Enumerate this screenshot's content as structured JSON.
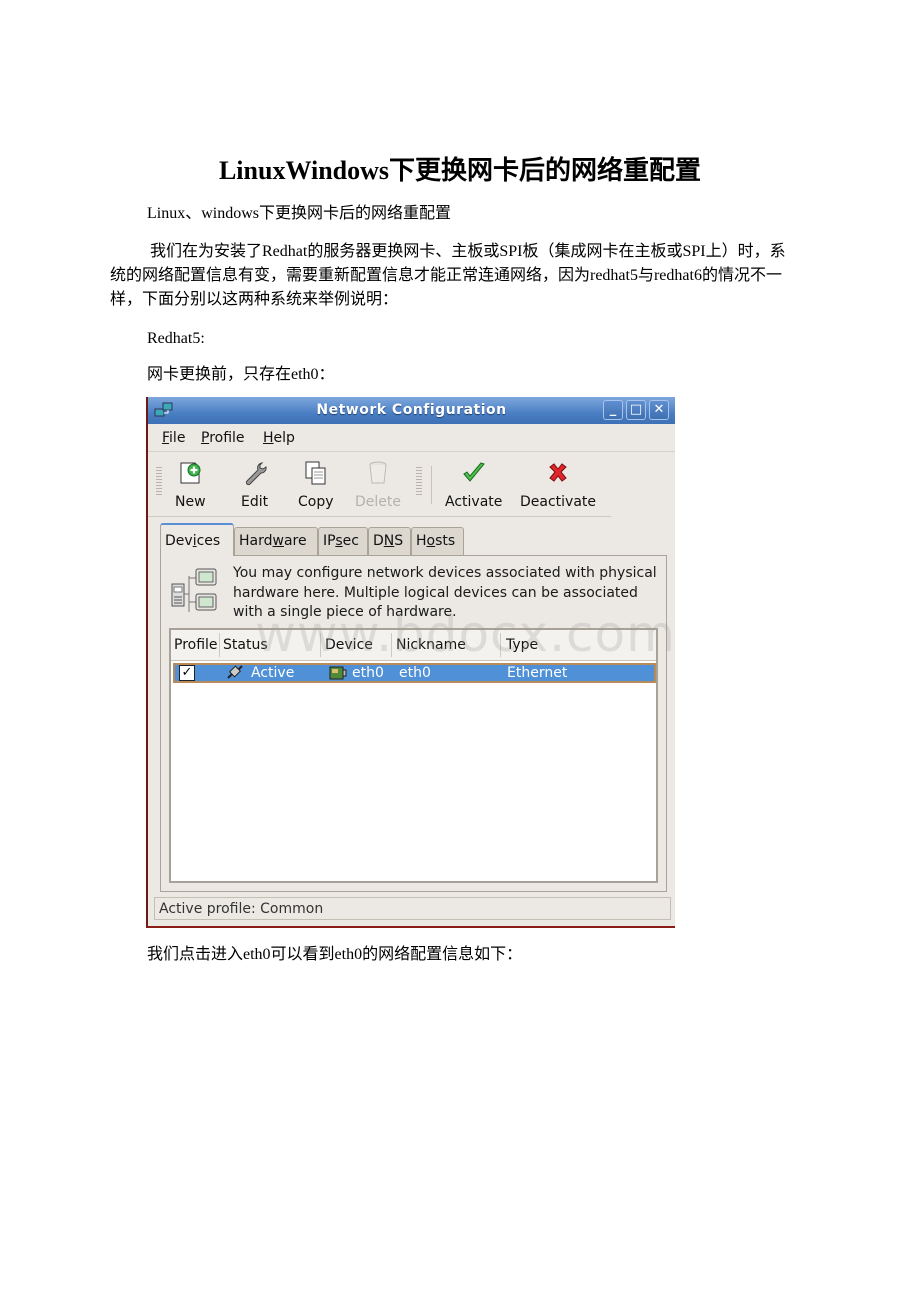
{
  "document": {
    "title": "LinuxWindows下更换网卡后的网络重配置",
    "subtitle": "Linux、windows下更换网卡后的网络重配置",
    "intro": "我们在为安装了Redhat的服务器更换网卡、主板或SPI板（集成网卡在主板或SPI上）时，系统的网络配置信息有变，需要重新配置信息才能正常连通网络，因为redhat5与redhat6的情况不一样，下面分别以这两种系统来举例说明：",
    "section": "Redhat5:",
    "before_caption": "网卡更换前，只存在eth0：",
    "after_caption": "我们点击进入eth0可以看到eth0的网络配置信息如下：",
    "watermark": "www.bdocx.com"
  },
  "window": {
    "title": "Network Configuration",
    "controls": {
      "minimize": "_",
      "maximize": "□",
      "close": "✕"
    },
    "menu": [
      {
        "label": "File",
        "mnemonic": "F",
        "rest": "ile"
      },
      {
        "label": "Profile",
        "mnemonic": "P",
        "rest": "rofile"
      },
      {
        "label": "Help",
        "mnemonic": "H",
        "rest": "elp"
      }
    ],
    "toolbar": [
      {
        "label": "New",
        "icon": "new-document-icon",
        "enabled": true
      },
      {
        "label": "Edit",
        "icon": "wrench-icon",
        "enabled": true
      },
      {
        "label": "Copy",
        "icon": "copy-icon",
        "enabled": true
      },
      {
        "label": "Delete",
        "icon": "trash-icon",
        "enabled": false
      },
      {
        "label": "Activate",
        "icon": "checkmark-icon",
        "enabled": true
      },
      {
        "label": "Deactivate",
        "icon": "red-x-icon",
        "enabled": true
      }
    ],
    "tabs": [
      {
        "pre": "Dev",
        "mn": "i",
        "post": "ces",
        "active": true
      },
      {
        "pre": "Hard",
        "mn": "w",
        "post": "are",
        "active": false
      },
      {
        "pre": "IP",
        "mn": "s",
        "post": "ec",
        "active": false
      },
      {
        "pre": "D",
        "mn": "N",
        "post": "S",
        "active": false
      },
      {
        "pre": "H",
        "mn": "o",
        "post": "sts",
        "active": false
      }
    ],
    "description": "You may configure network devices associated with physical hardware here.  Multiple logical devices can be associated with a single piece of hardware.",
    "columns": [
      "Profile",
      "Status",
      "Device",
      "Nickname",
      "Type"
    ],
    "rows": [
      {
        "profile_checked": true,
        "check_glyph": "✓",
        "status": "Active",
        "device": "eth0",
        "nickname": "eth0",
        "type": "Ethernet",
        "selected": true
      }
    ],
    "status_bar": "Active profile: Common"
  },
  "colors": {
    "titlebar": "#4a7fc4",
    "selection": "#4f90d6",
    "window_bg": "#ece9e4"
  }
}
